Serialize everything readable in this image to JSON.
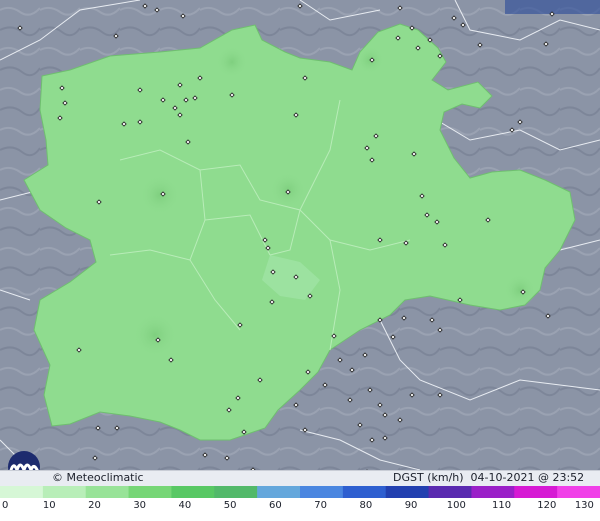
{
  "brand": {
    "name": "Meteoclimatic",
    "logo_icon": "meteoclimatic-logo-icon"
  },
  "product": {
    "label": "DGST (km/h)",
    "datetime": "04-10-2021 @ 23:52 UTC"
  },
  "scale": {
    "ticks": [
      "0",
      "10",
      "20",
      "30",
      "40",
      "50",
      "60",
      "70",
      "80",
      "90",
      "100",
      "110",
      "120",
      "130"
    ],
    "colors": [
      "#d6f7d6",
      "#b8eeb8",
      "#98e398",
      "#76d676",
      "#58c864",
      "#52b96a",
      "#64a7dc",
      "#4a86e0",
      "#2e5fd0",
      "#2240b0",
      "#5a2ab0",
      "#9a20c8",
      "#d61ad4",
      "#f040e8"
    ]
  },
  "map": {
    "region_fill": "#8fdc8f",
    "background": "#8a93a4"
  }
}
